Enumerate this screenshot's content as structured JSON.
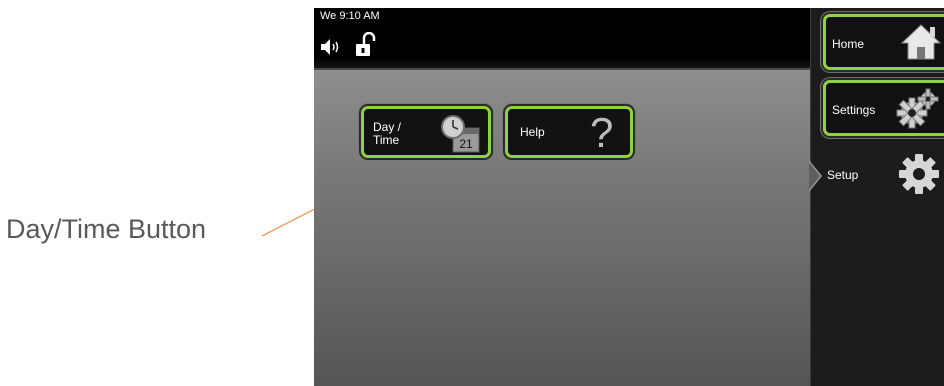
{
  "callout": {
    "label": "Day/Time Button"
  },
  "status_bar": {
    "time": "We 9:10 AM"
  },
  "main": {
    "daytime_button": {
      "label": "Day /\nTime",
      "calendar_day": "21"
    },
    "help_button": {
      "label": "Help",
      "symbol": "?"
    }
  },
  "sidebar": {
    "home": {
      "label": "Home"
    },
    "settings": {
      "label": "Settings"
    },
    "setup": {
      "label": "Setup"
    }
  },
  "colors": {
    "accent_green": "#8fd13f",
    "callout_arrow": "#f0a060"
  },
  "icons": [
    "speaker-icon",
    "unlock-icon",
    "clock-calendar-icon",
    "help-icon",
    "home-icon",
    "gears-icon",
    "gear-icon"
  ]
}
